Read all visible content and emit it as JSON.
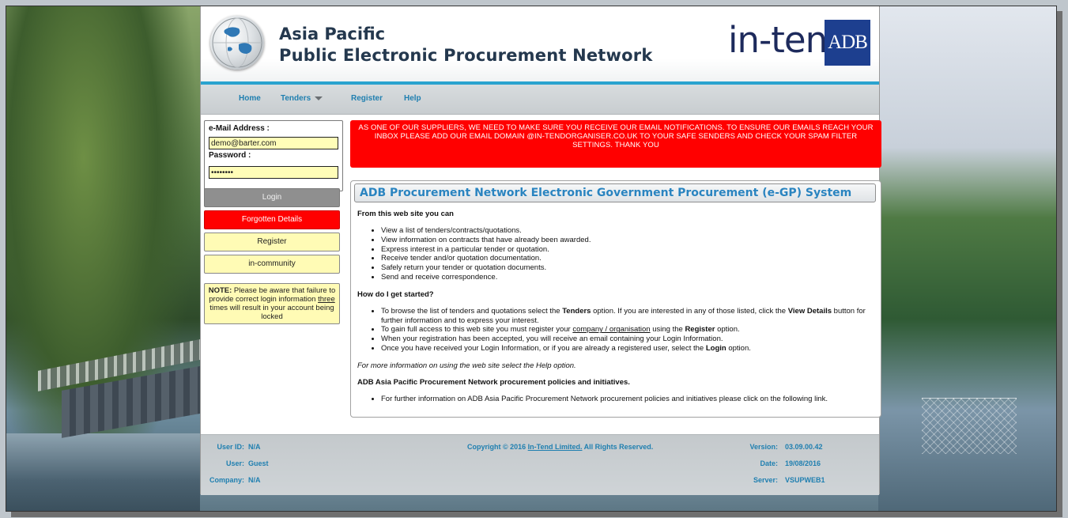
{
  "header": {
    "title_line1": "Asia Pacific",
    "title_line2": "Public Electronic Procurement Network",
    "brand_intend": "in-tend",
    "brand_adb": "ADB"
  },
  "nav": {
    "home": "Home",
    "tenders": "Tenders",
    "register": "Register",
    "help": "Help"
  },
  "login": {
    "email_label": "e-Mail Address :",
    "email_value": "demo@barter.com",
    "password_label": "Password :",
    "password_value": "••••••••",
    "login_button": "Login",
    "forgotten_button": "Forgotten Details",
    "register_button": "Register",
    "community_button": "in-community",
    "note_strong": "NOTE:",
    "note_text_1": "Please be aware that failure to provide correct login information",
    "note_underline": "three",
    "note_text_2": "times will result in your account being locked"
  },
  "banner": {
    "text": "AS ONE OF OUR SUPPLIERS, WE NEED TO MAKE SURE YOU RECEIVE OUR EMAIL NOTIFICATIONS. TO ENSURE OUR EMAILS REACH YOUR INBOX PLEASE ADD OUR EMAIL DOMAIN @IN-TENDORGANISER.CO.UK TO YOUR SAFE SENDERS AND CHECK YOUR SPAM FILTER SETTINGS. THANK YOU"
  },
  "panel": {
    "title": "ADB Procurement Network Electronic Government Procurement (e-GP) System",
    "intro_heading": "From this web site you can",
    "intro_items": [
      "View a list of tenders/contracts/quotations.",
      "View information on contracts that have already been awarded.",
      "Express interest in a particular tender or quotation.",
      "Receive tender and/or quotation documentation.",
      "Safely return your tender or quotation documents.",
      "Send and receive correspondence."
    ],
    "start_heading": "How do I get started?",
    "start_1a": "To browse the list of tenders and quotations select the",
    "start_1b": "Tenders",
    "start_1c": "option. If you are interested in any of those listed, click the",
    "start_1d": "View Details",
    "start_1e": "button for further information and to express your interest.",
    "start_2a": "To gain full access to this web site you must register your",
    "start_2b": "company / organisation",
    "start_2c": "using the",
    "start_2d": "Register",
    "start_2e": "option.",
    "start_3": "When your registration has been accepted, you will receive an email containing your Login Information.",
    "start_4a": "Once you have received your Login Information, or if you are already a registered user, select the",
    "start_4b": "Login",
    "start_4c": "option.",
    "help_note": "For more information on using the web site select the Help option.",
    "policies_heading": "ADB Asia Pacific Procurement Network procurement policies and initiatives.",
    "policies_item": "For further information on ADB Asia Pacific Procurement Network procurement policies and initiatives please click on the following link."
  },
  "footer": {
    "user_id_label": "User ID:",
    "user_id_value": "N/A",
    "user_label": "User:",
    "user_value": "Guest",
    "company_label": "Company:",
    "company_value": "N/A",
    "copyright_prefix": "Copyright © 2016",
    "copyright_link": "In-Tend Limited.",
    "copyright_suffix": "All Rights Reserved.",
    "version_label": "Version:",
    "version_value": "03.09.00.42",
    "date_label": "Date:",
    "date_value": "19/08/2016",
    "server_label": "Server:",
    "server_value": "VSUPWEB1"
  },
  "colors": {
    "accent_blue": "#2aa3cf",
    "link_blue": "#1f7fb0",
    "alert_red": "#ff0000",
    "input_yellow": "#fffdb8",
    "brand_navy": "#1d3f8f"
  }
}
